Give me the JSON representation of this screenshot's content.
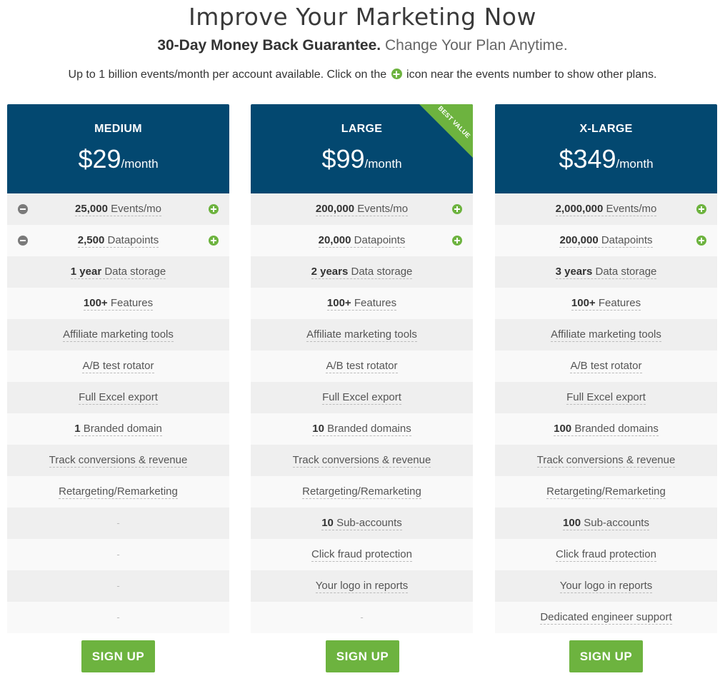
{
  "header": {
    "title": "Improve Your Marketing Now",
    "guarantee": "30-Day Money Back Guarantee.",
    "change": "Change Your Plan Anytime.",
    "info_before": "Up to 1 billion events/month per account available. Click on the",
    "info_after": "icon near the events number to show other plans."
  },
  "colors": {
    "header_bg": "#034870",
    "accent_green": "#6db33f"
  },
  "plans": [
    {
      "name": "MEDIUM",
      "price": "$29",
      "per": "/month",
      "signup": "SIGN UP",
      "rows": [
        {
          "bold": "25,000",
          "text": "Events/mo",
          "controls": true,
          "minus": true
        },
        {
          "bold": "2,500",
          "text": "Datapoints",
          "controls": true,
          "minus": true
        },
        {
          "bold": "1 year",
          "text": "Data storage"
        },
        {
          "bold": "100+",
          "text": "Features"
        },
        {
          "bold": "",
          "text": "Affiliate marketing tools"
        },
        {
          "bold": "",
          "text": "A/B test rotator"
        },
        {
          "bold": "",
          "text": "Full Excel export"
        },
        {
          "bold": "1",
          "text": "Branded domain"
        },
        {
          "bold": "",
          "text": "Track conversions & revenue"
        },
        {
          "bold": "",
          "text": "Retargeting/Remarketing"
        },
        {
          "dash": "-"
        },
        {
          "dash": "-"
        },
        {
          "dash": "-"
        },
        {
          "dash": "-"
        }
      ]
    },
    {
      "name": "LARGE",
      "price": "$99",
      "per": "/month",
      "signup": "SIGN UP",
      "ribbon": "BEST VALUE",
      "rows": [
        {
          "bold": "200,000",
          "text": "Events/mo",
          "controls": true
        },
        {
          "bold": "20,000",
          "text": "Datapoints",
          "controls": true
        },
        {
          "bold": "2 years",
          "text": "Data storage"
        },
        {
          "bold": "100+",
          "text": "Features"
        },
        {
          "bold": "",
          "text": "Affiliate marketing tools"
        },
        {
          "bold": "",
          "text": "A/B test rotator"
        },
        {
          "bold": "",
          "text": "Full Excel export"
        },
        {
          "bold": "10",
          "text": "Branded domains"
        },
        {
          "bold": "",
          "text": "Track conversions & revenue"
        },
        {
          "bold": "",
          "text": "Retargeting/Remarketing"
        },
        {
          "bold": "10",
          "text": "Sub-accounts"
        },
        {
          "bold": "",
          "text": "Click fraud protection"
        },
        {
          "bold": "",
          "text": "Your logo in reports"
        },
        {
          "dash": "-"
        }
      ]
    },
    {
      "name": "X-LARGE",
      "price": "$349",
      "per": "/month",
      "signup": "SIGN UP",
      "rows": [
        {
          "bold": "2,000,000",
          "text": "Events/mo",
          "controls": true
        },
        {
          "bold": "200,000",
          "text": "Datapoints",
          "controls": true
        },
        {
          "bold": "3 years",
          "text": "Data storage"
        },
        {
          "bold": "100+",
          "text": "Features"
        },
        {
          "bold": "",
          "text": "Affiliate marketing tools"
        },
        {
          "bold": "",
          "text": "A/B test rotator"
        },
        {
          "bold": "",
          "text": "Full Excel export"
        },
        {
          "bold": "100",
          "text": "Branded domains"
        },
        {
          "bold": "",
          "text": "Track conversions & revenue"
        },
        {
          "bold": "",
          "text": "Retargeting/Remarketing"
        },
        {
          "bold": "100",
          "text": "Sub-accounts"
        },
        {
          "bold": "",
          "text": "Click fraud protection"
        },
        {
          "bold": "",
          "text": "Your logo in reports"
        },
        {
          "bold": "",
          "text": "Dedicated engineer support"
        }
      ]
    }
  ]
}
